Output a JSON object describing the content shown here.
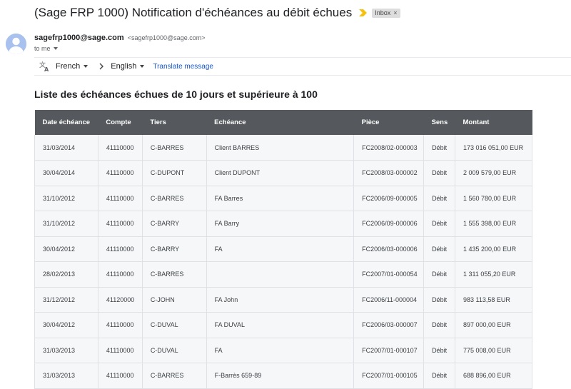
{
  "email": {
    "subject": "(Sage FRP 1000) Notification d'échéances au débit échues",
    "label": "Inbox",
    "label_remove": "×",
    "sender_name": "sagefrp1000@sage.com",
    "sender_email": "<sagefrp1000@sage.com>",
    "recipient": "to me"
  },
  "translate": {
    "source_lang": "French",
    "target_lang": "English",
    "link": "Translate message"
  },
  "body": {
    "heading": "Liste des échéances échues de 10 jours et supérieure à 100",
    "table": {
      "headers": [
        "Date échéance",
        "Compte",
        "Tiers",
        "Echéance",
        "Pièce",
        "Sens",
        "Montant"
      ],
      "rows": [
        [
          "31/03/2014",
          "41110000",
          "C-BARRES",
          "Client BARRES",
          "FC2008/02-000003",
          "Débit",
          "173 016 051,00 EUR"
        ],
        [
          "30/04/2014",
          "41110000",
          "C-DUPONT",
          "Client DUPONT",
          "FC2008/03-000002",
          "Débit",
          "2 009 579,00 EUR"
        ],
        [
          "31/10/2012",
          "41110000",
          "C-BARRES",
          "FA Barres",
          "FC2006/09-000005",
          "Débit",
          "1 560 780,00 EUR"
        ],
        [
          "31/10/2012",
          "41110000",
          "C-BARRY",
          "FA Barry",
          "FC2006/09-000006",
          "Débit",
          "1 555 398,00 EUR"
        ],
        [
          "30/04/2012",
          "41110000",
          "C-BARRY",
          "FA",
          "FC2006/03-000006",
          "Débit",
          "1 435 200,00 EUR"
        ],
        [
          "28/02/2013",
          "41110000",
          "C-BARRES",
          "",
          "FC2007/01-000054",
          "Débit",
          "1 311 055,20 EUR"
        ],
        [
          "31/12/2012",
          "41120000",
          "C-JOHN",
          "FA John",
          "FC2006/11-000004",
          "Débit",
          "983 113,58 EUR"
        ],
        [
          "30/04/2012",
          "41110000",
          "C-DUVAL",
          "FA DUVAL",
          "FC2006/03-000007",
          "Débit",
          "897 000,00 EUR"
        ],
        [
          "31/03/2013",
          "41110000",
          "C-DUVAL",
          "FA",
          "FC2007/01-000107",
          "Débit",
          "775 008,00 EUR"
        ],
        [
          "31/03/2013",
          "41110000",
          "C-BARRES",
          "F-Barrès 659-89",
          "FC2007/01-000105",
          "Débit",
          "688 896,00 EUR"
        ]
      ]
    }
  },
  "colors": {
    "table_header_bg": "#55585c",
    "importance_marker": "#f4c20d",
    "avatar_bg": "#a8c1ee",
    "link": "#1a57c9"
  },
  "icons": {
    "importance": "importance-marker-icon",
    "avatar": "avatar-icon",
    "translate": "translate-icon",
    "arrow": "chevron-right-icon",
    "caret": "caret-down-icon"
  }
}
